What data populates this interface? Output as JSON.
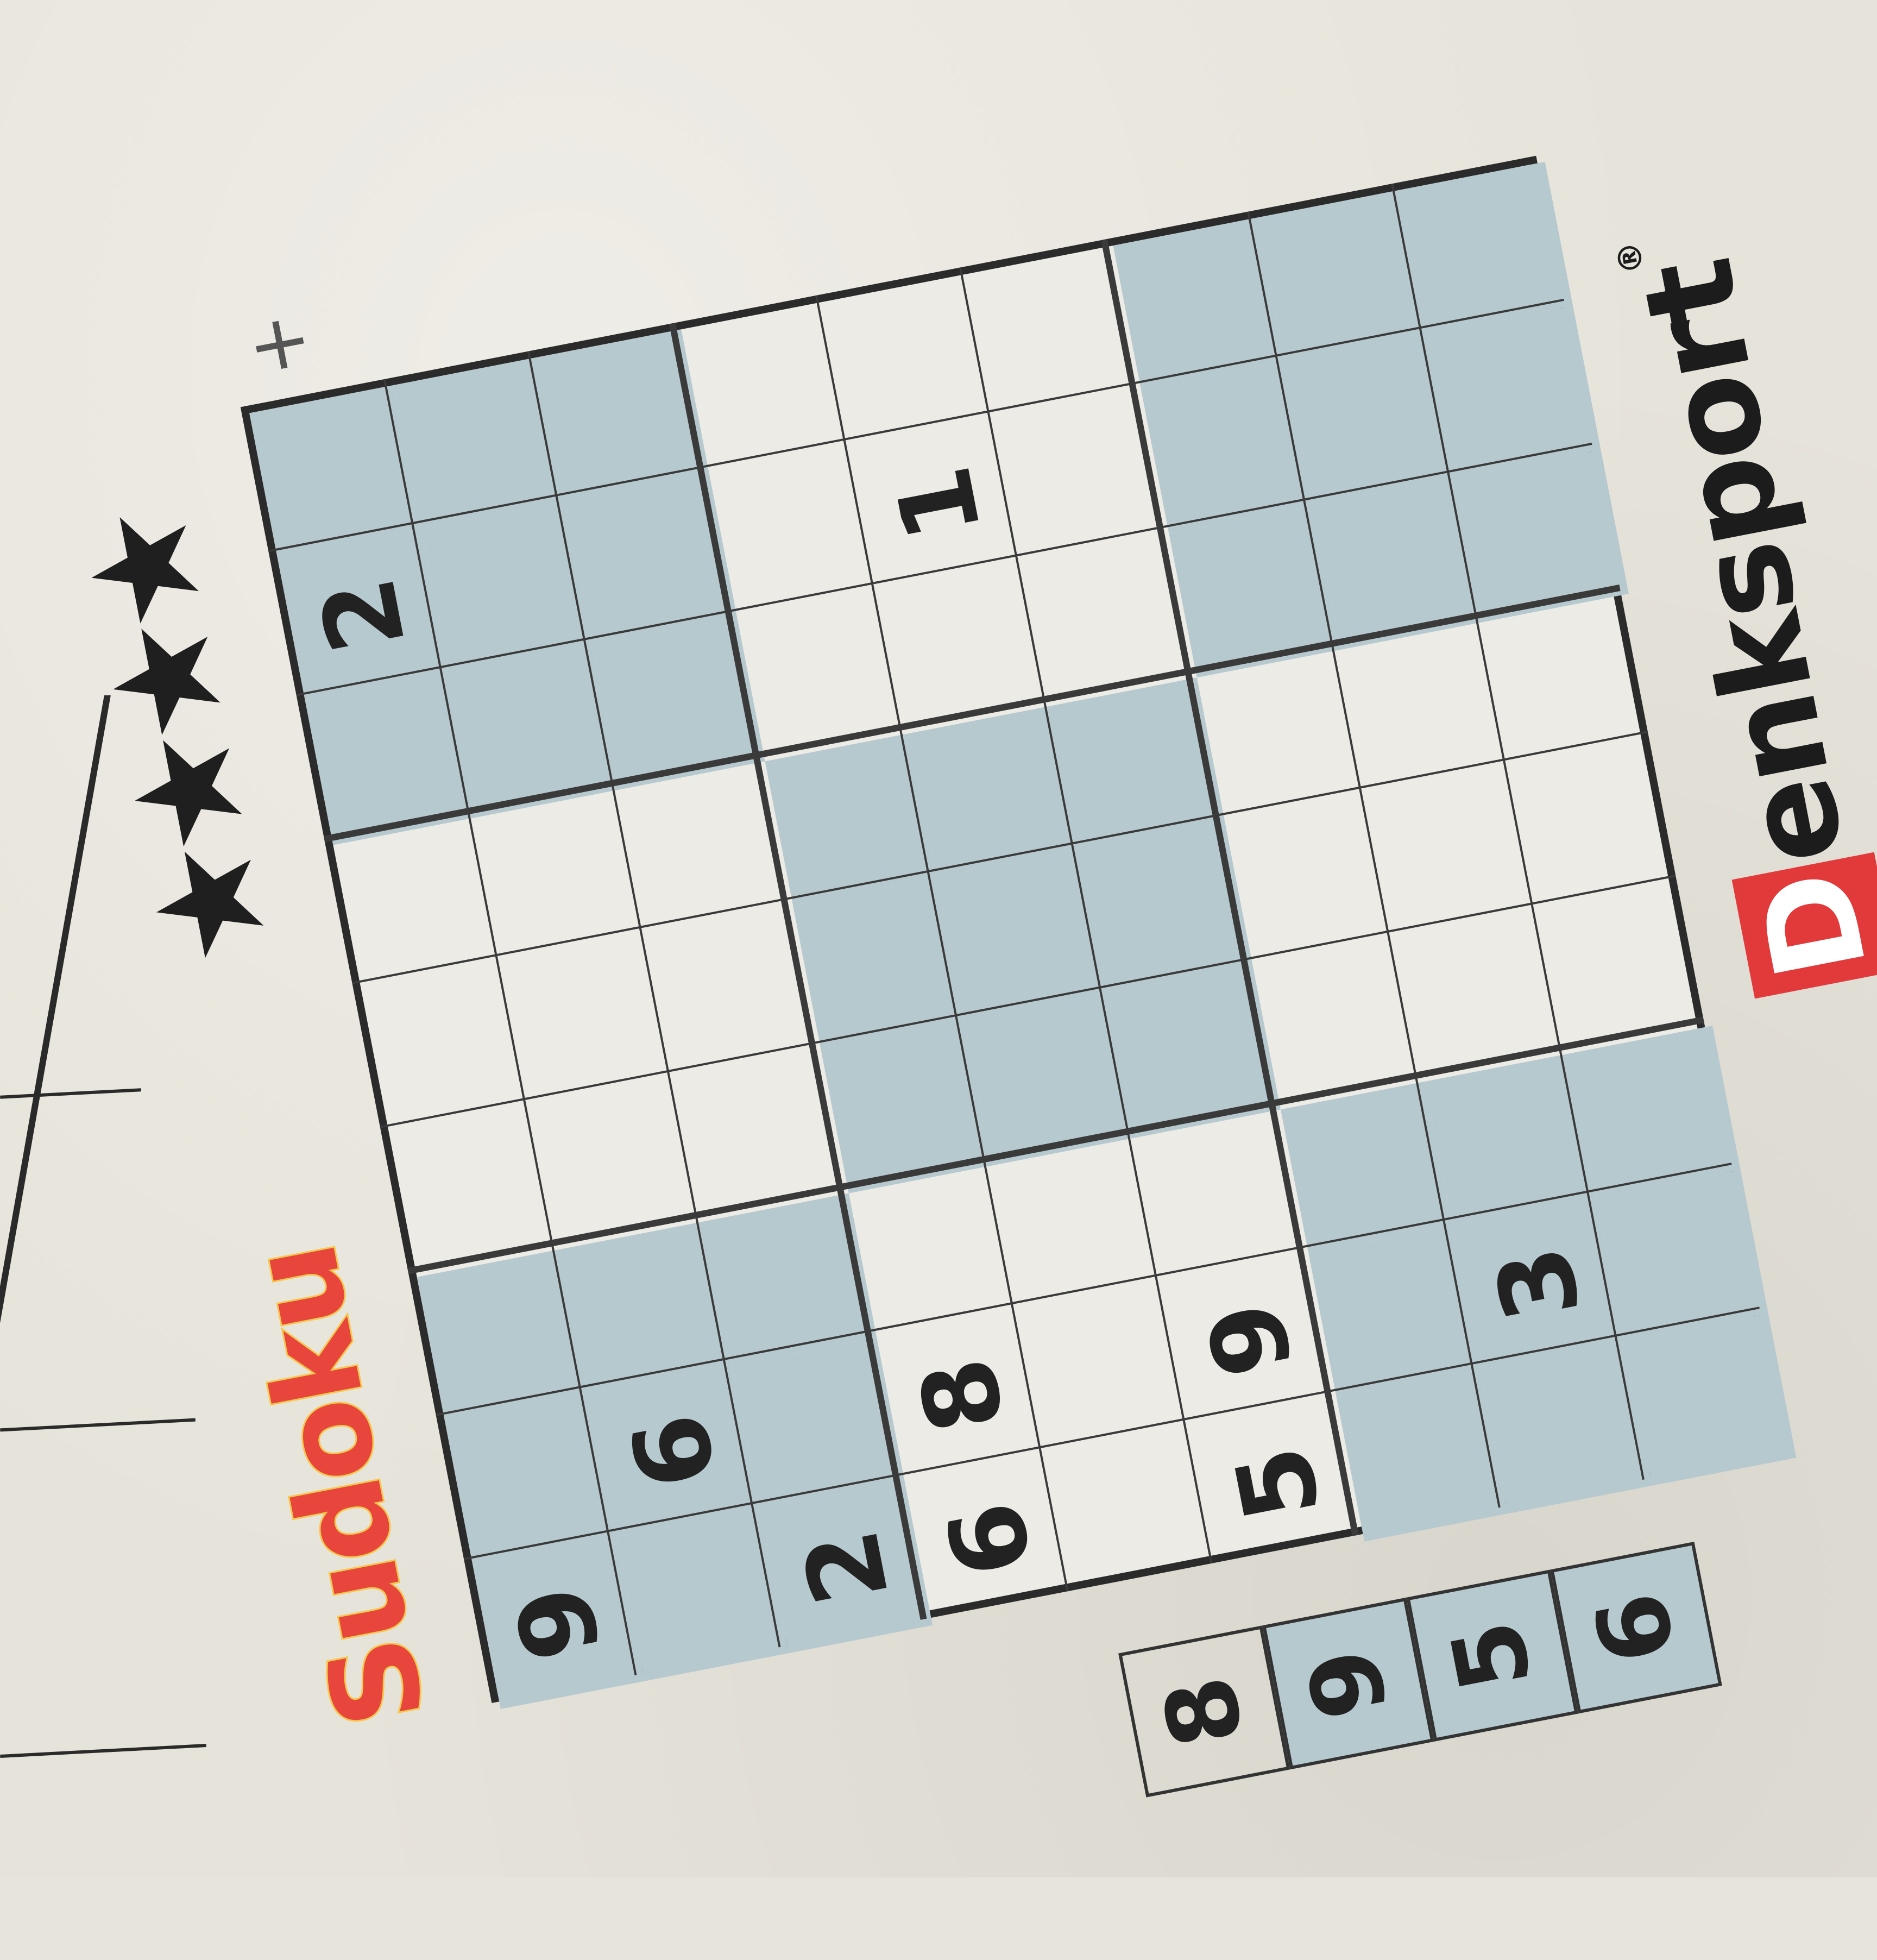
{
  "puzzle": {
    "title": "Sudoku",
    "difficulty_stars": 4,
    "star_glyph": "★",
    "brand_initial": "D",
    "brand_rest": "enksport",
    "brand_mark": "®",
    "grid": [
      [
        "9",
        "",
        "",
        "",
        "",
        "",
        "",
        "2",
        ""
      ],
      [
        "",
        "6",
        "",
        "",
        "",
        "",
        "",
        "",
        ""
      ],
      [
        "2",
        "",
        "",
        "",
        "",
        "",
        "",
        "",
        ""
      ],
      [
        "6",
        "8",
        "",
        "",
        "",
        "",
        "",
        "",
        ""
      ],
      [
        "",
        "",
        "",
        "",
        "",
        "",
        "",
        "1",
        ""
      ],
      [
        "5",
        "9",
        "",
        "",
        "",
        "",
        "",
        "",
        ""
      ],
      [
        "",
        "",
        "",
        "",
        "",
        "",
        "",
        "",
        ""
      ],
      [
        "",
        "3",
        "",
        "",
        "",
        "",
        "",
        "",
        ""
      ],
      [
        "",
        "",
        "",
        "",
        "",
        "",
        "",
        "",
        ""
      ]
    ],
    "colors": {
      "shade": "#b6c9cf",
      "title": "#e8453c",
      "title_outline": "#f4c84a",
      "brand_red": "#e23a3a"
    }
  },
  "neighbor_puzzle": {
    "visible_digits": [
      "8",
      "9",
      "5",
      "6"
    ]
  }
}
